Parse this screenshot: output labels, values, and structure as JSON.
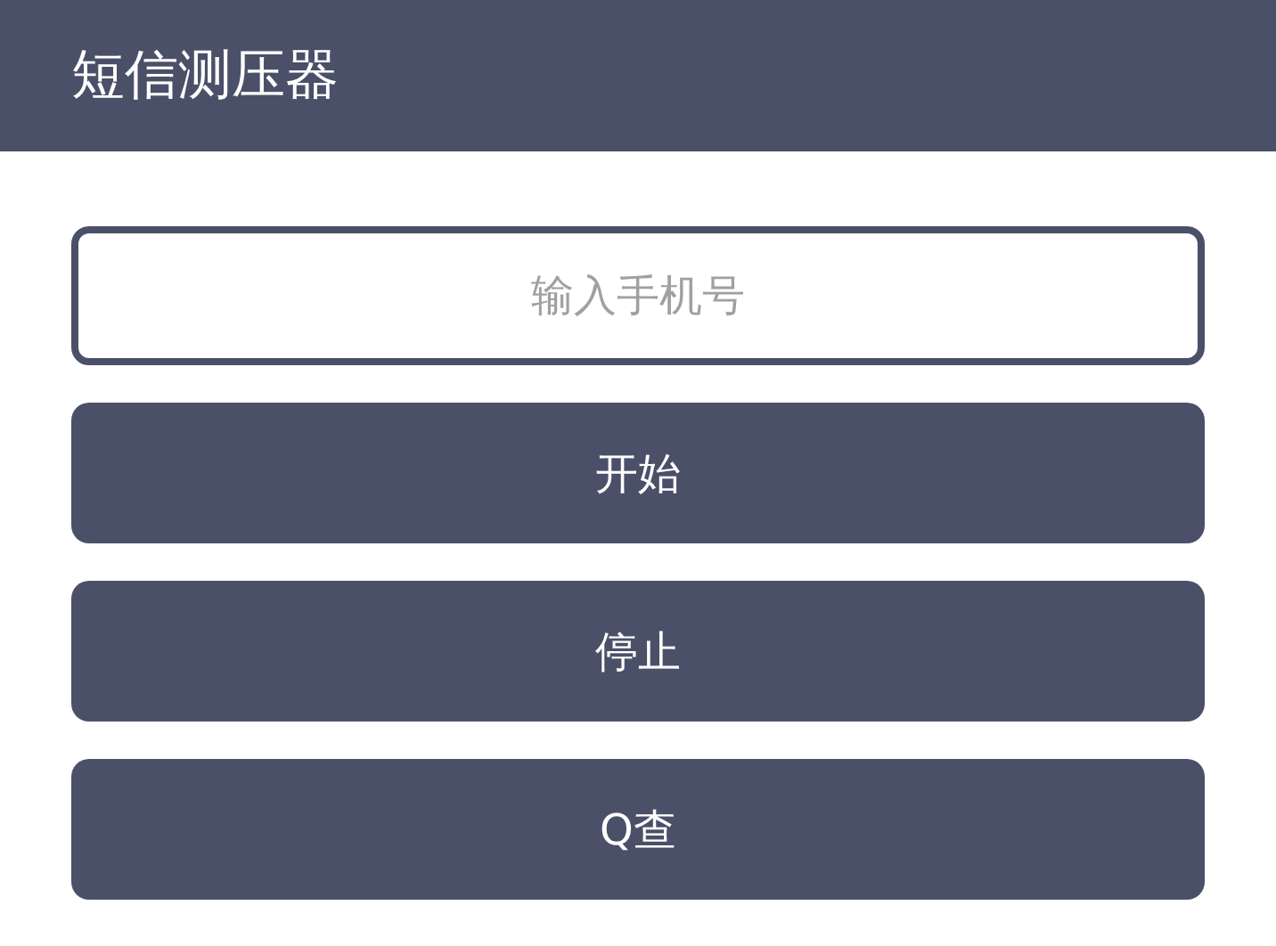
{
  "header": {
    "title": "短信测压器"
  },
  "phone_field": {
    "placeholder": "输入手机号"
  },
  "buttons": [
    "开始",
    "停止",
    "Q查"
  ]
}
